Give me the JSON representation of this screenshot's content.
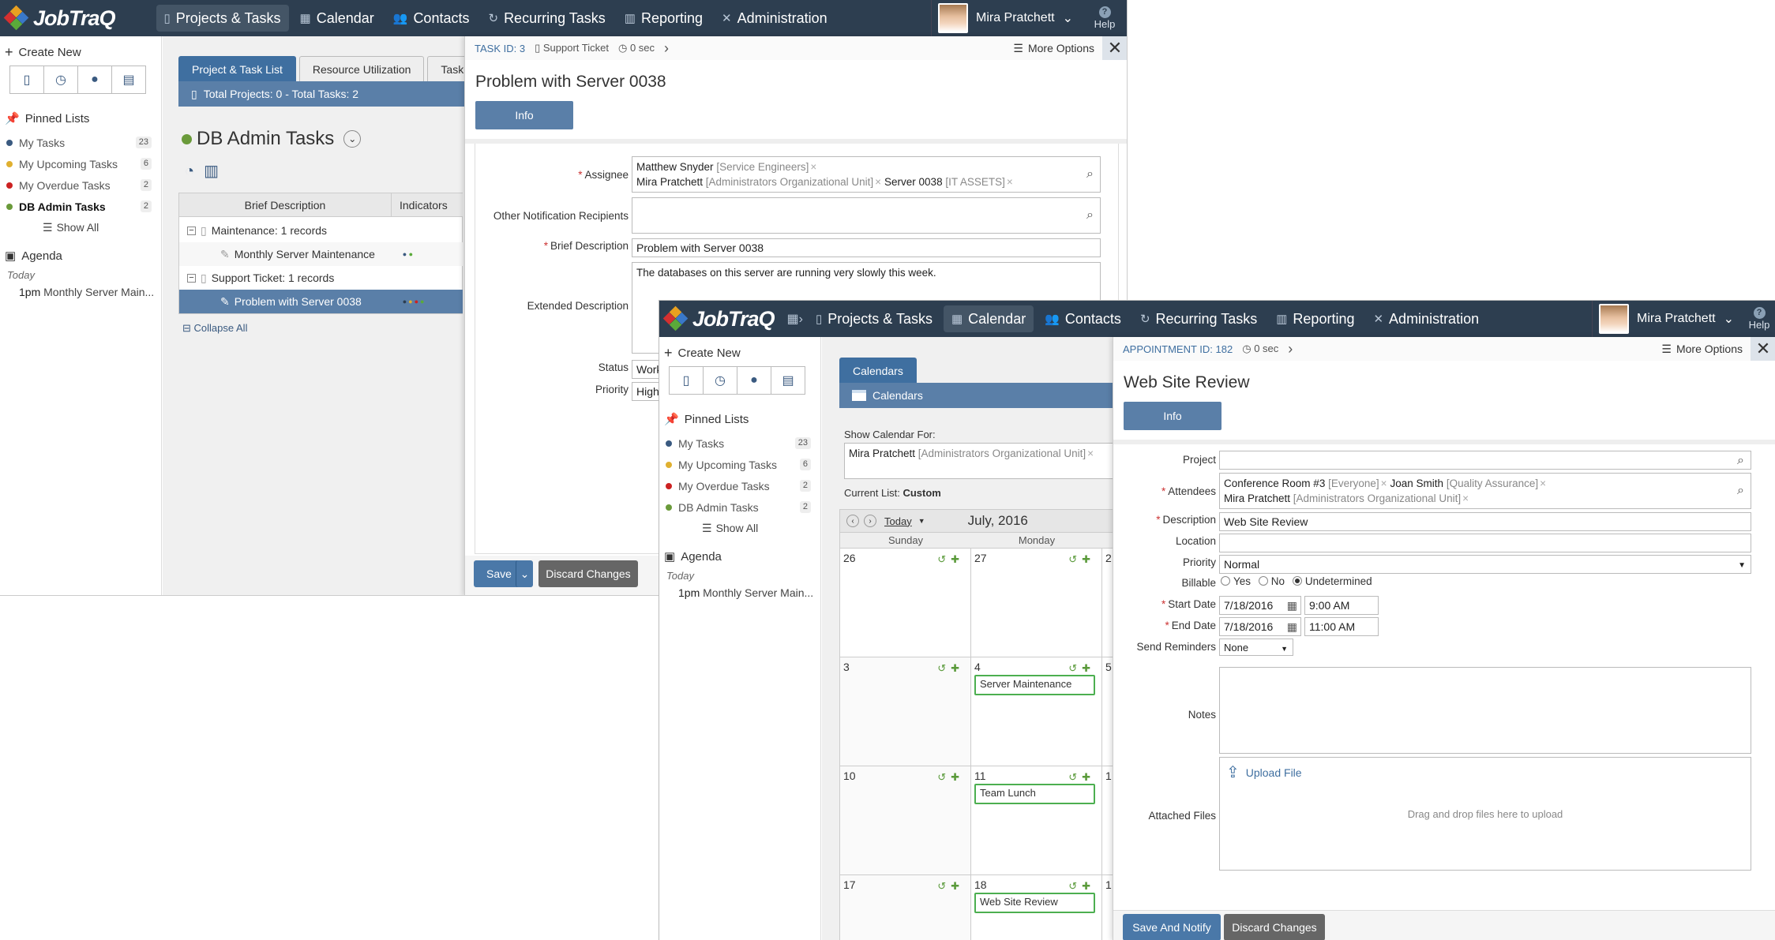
{
  "app": {
    "brand": "JobTraQ"
  },
  "nav": {
    "projects": "Projects & Tasks",
    "calendar": "Calendar",
    "contacts": "Contacts",
    "recurring": "Recurring Tasks",
    "reporting": "Reporting",
    "administration": "Administration",
    "user": "Mira Pratchett",
    "help": "Help"
  },
  "sidebar": {
    "create_new": "Create New",
    "pinned_lists": "Pinned Lists",
    "pins": [
      {
        "label": "My Tasks",
        "count": "23",
        "color": "#3a5a80"
      },
      {
        "label": "My Upcoming Tasks",
        "count": "6",
        "color": "#e0b030"
      },
      {
        "label": "My Overdue Tasks",
        "count": "2",
        "color": "#cc2222"
      },
      {
        "label": "DB Admin Tasks",
        "count": "2",
        "color": "#6a9a3a"
      }
    ],
    "show_all": "Show All",
    "agenda": "Agenda",
    "today": "Today",
    "agenda_time": "1pm",
    "agenda_item": "Monthly Server Main..."
  },
  "projects": {
    "tab1": "Project & Task List",
    "tab2": "Resource Utilization",
    "tab3": "Task",
    "totals": "Total Projects: 0 - Total Tasks: 2",
    "list_title": "DB Admin Tasks",
    "col_brief": "Brief Description",
    "col_indicators": "Indicators",
    "group1": "Maintenance: 1 records",
    "item1": "Monthly Server Maintenance",
    "group2": "Support Ticket: 1 records",
    "item2": "Problem with Server 0038",
    "collapse_all": "Collapse All"
  },
  "task": {
    "id_label": "TASK ID:",
    "id": "3",
    "type": "Support Ticket",
    "timer": "0 sec",
    "more_options": "More Options",
    "title": "Problem with Server 0038",
    "info_tab": "Info",
    "assignee_label": "Assignee",
    "assignee1_name": "Matthew Snyder",
    "assignee1_tag": "[Service Engineers]",
    "assignee2_name": "Mira Pratchett",
    "assignee2_tag": "[Administrators Organizational Unit]",
    "assignee3_name": "Server 0038",
    "assignee3_tag": "[IT ASSETS]",
    "other_label": "Other Notification Recipients",
    "brief_label": "Brief Description",
    "brief_value": "Problem with Server 0038",
    "ext_label": "Extended Description",
    "ext_value": "The databases on this server are running very slowly this week.",
    "status_label": "Status",
    "status_value": "Work",
    "priority_label": "Priority",
    "priority_value": "High",
    "save": "Save",
    "discard": "Discard Changes"
  },
  "calendar": {
    "tab": "Calendars",
    "bar": "Calendars",
    "show_for_label": "Show Calendar For:",
    "show_for_name": "Mira Pratchett",
    "show_for_tag": "[Administrators Organizational Unit]",
    "current_list_label": "Current List:",
    "current_list_value": "Custom",
    "today_btn": "Today",
    "month": "July, 2016",
    "day1": "Sunday",
    "day2": "Monday",
    "weeks": [
      {
        "sun": "26",
        "mon": "27",
        "next": "2",
        "event": ""
      },
      {
        "sun": "3",
        "mon": "4",
        "next": "5",
        "event": "Server Maintenance"
      },
      {
        "sun": "10",
        "mon": "11",
        "next": "1",
        "event": "Team Lunch"
      },
      {
        "sun": "17",
        "mon": "18",
        "next": "1",
        "event": "Web Site Review"
      }
    ]
  },
  "appt": {
    "id_label": "APPOINTMENT",
    "id_prefix": "ID:",
    "id": "182",
    "timer": "0 sec",
    "more_options": "More Options",
    "title": "Web Site Review",
    "info_tab": "Info",
    "project_label": "Project",
    "attendees_label": "Attendees",
    "att1_name": "Conference Room #3",
    "att1_tag": "[Everyone]",
    "att2_name": "Joan Smith",
    "att2_tag": "[Quality Assurance]",
    "att3_name": "Mira Pratchett",
    "att3_tag": "[Administrators Organizational Unit]",
    "desc_label": "Description",
    "desc_value": "Web Site Review",
    "location_label": "Location",
    "priority_label": "Priority",
    "priority_value": "Normal",
    "billable_label": "Billable",
    "billable_yes": "Yes",
    "billable_no": "No",
    "billable_und": "Undetermined",
    "start_label": "Start Date",
    "start_date": "7/18/2016",
    "start_time": "9:00 AM",
    "end_label": "End Date",
    "end_date": "7/18/2016",
    "end_time": "11:00 AM",
    "reminders_label": "Send Reminders",
    "reminders_value": "None",
    "notes_label": "Notes",
    "files_label": "Attached Files",
    "upload": "Upload File",
    "drag": "Drag and drop files here to upload",
    "save": "Save And Notify",
    "discard": "Discard Changes"
  }
}
